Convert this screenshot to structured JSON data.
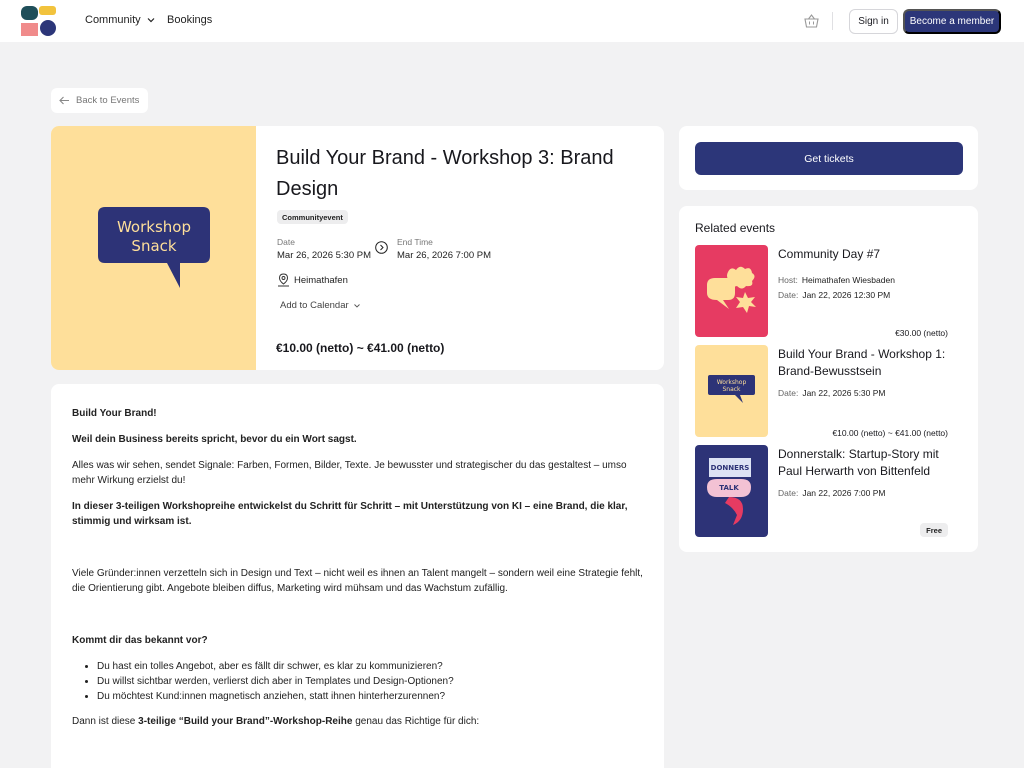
{
  "header": {
    "nav": {
      "community": "Community",
      "bookings": "Bookings"
    },
    "sign_in": "Sign in",
    "become_member": "Become a member"
  },
  "back_label": "Back to Events",
  "event": {
    "image_text_line1": "Workshop",
    "image_text_line2": "Snack",
    "title": "Build Your Brand - Workshop 3: Brand Design",
    "category": "Communityevent",
    "date_label": "Date",
    "date_value": "Mar 26, 2026 5:30 PM",
    "end_label": "End Time",
    "end_value": "Mar 26, 2026 7:00 PM",
    "venue": "Heimathafen",
    "add_to_calendar": "Add to Calendar",
    "price": "€10.00 (netto) ~ €41.00 (netto)"
  },
  "description": {
    "p1": "Build Your Brand!",
    "p2": "Weil dein Business bereits spricht, bevor du ein Wort sagst.",
    "p3": "Alles was wir sehen, sendet Signale: Farben, Formen, Bilder, Texte. Je bewusster und strategischer du das gestaltest – umso mehr Wirkung erzielst du!",
    "p4": "In dieser 3-teiligen Workshopreihe entwickelst du Schritt für Schritt – mit Unterstützung von KI – eine Brand, die klar, stimmig und wirksam ist.",
    "p5": "Viele Gründer:innen verzetteln sich in Design und Text – nicht weil es ihnen an Talent mangelt – sondern weil eine Strategie fehlt, die Orientierung gibt. Angebote bleiben diffus, Marketing wird mühsam und das Wachstum zufällig.",
    "p6": "Kommt dir das bekannt vor?",
    "bullets": [
      "Du hast ein tolles Angebot, aber es fällt dir schwer, es klar zu kommunizieren?",
      "Du willst sichtbar werden, verlierst dich aber in Templates und Design-Optionen?",
      "Du möchtest Kund:innen magnetisch anziehen, statt ihnen hinterherzurennen?"
    ],
    "p7_pre": "Dann ist diese ",
    "p7_bold": "3-teilige “Build your Brand”-Workshop-Reihe",
    "p7_post": " genau das Richtige für dich:"
  },
  "tickets": {
    "button": "Get tickets"
  },
  "related": {
    "title": "Related events",
    "items": [
      {
        "name": "Community Day #7",
        "host_label": "Host:",
        "host": "Heimathafen Wiesbaden",
        "date_label": "Date:",
        "date": "Jan 22, 2026 12:30 PM",
        "price": "€30.00 (netto)"
      },
      {
        "name": "Build Your Brand - Workshop 1: Brand-Bewusstsein",
        "date_label": "Date:",
        "date": "Jan 22, 2026 5:30 PM",
        "price": "€10.00 (netto) ~ €41.00 (netto)",
        "thumb_text1": "Workshop",
        "thumb_text2": "Snack"
      },
      {
        "name": "Donnerstalk: Startup-Story mit Paul Herwarth von Bittenfeld",
        "date_label": "Date:",
        "date": "Jan 22, 2026 7:00 PM",
        "price": "Free",
        "thumb_text1": "DONNERS",
        "thumb_text2": "TALK"
      }
    ]
  },
  "colors": {
    "primary": "#2c3679",
    "workshop_bg": "#fedf9a",
    "community_bg": "#e63b62",
    "donners_bg": "#2d3377"
  }
}
